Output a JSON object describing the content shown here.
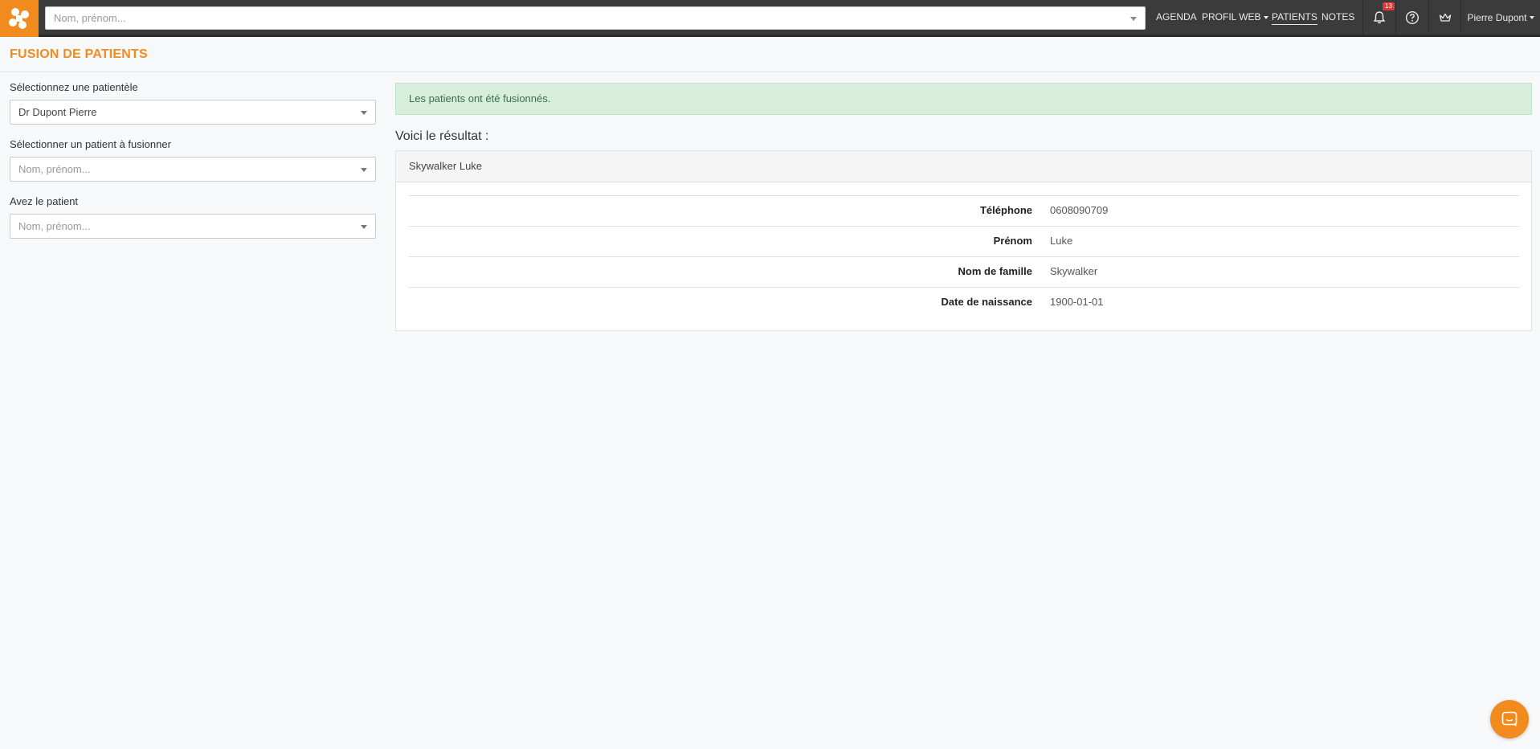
{
  "header": {
    "search_placeholder": "Nom, prénom...",
    "nav": [
      {
        "label": "AGENDA"
      },
      {
        "label": "PROFIL WEB"
      },
      {
        "label": "PATIENTS"
      },
      {
        "label": "NOTES"
      }
    ],
    "notification_count": "13",
    "user_name": "Pierre Dupont"
  },
  "page": {
    "title": "FUSION DE PATIENTS"
  },
  "form": {
    "patientele_label": "Sélectionnez une patientèle",
    "patientele_value": "Dr Dupont Pierre",
    "patient_label": "Sélectionner un patient à fusionner",
    "patient_placeholder": "Nom, prénom...",
    "with_label": "Avez le patient",
    "with_placeholder": "Nom, prénom..."
  },
  "result": {
    "alert": "Les patients ont été fusionnés.",
    "heading": "Voici le résultat :",
    "patient_name": "Skywalker Luke",
    "rows": [
      {
        "key": "Téléphone",
        "value": "0608090709"
      },
      {
        "key": "Prénom",
        "value": "Luke"
      },
      {
        "key": "Nom de famille",
        "value": "Skywalker"
      },
      {
        "key": "Date de naissance",
        "value": "1900-01-01"
      }
    ]
  },
  "colors": {
    "brand": "#f28b1e",
    "topbar": "#3b3b3b",
    "alert_bg": "#d6eedb",
    "badge": "#e53935"
  }
}
